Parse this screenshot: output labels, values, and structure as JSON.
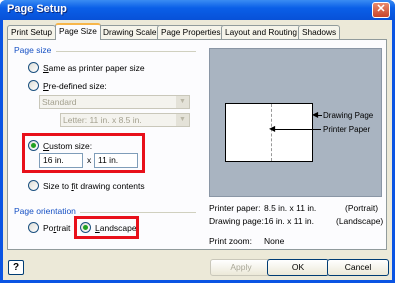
{
  "window": {
    "title": "Page Setup",
    "close_glyph": "✕"
  },
  "tabs": [
    {
      "label": "Print Setup",
      "active": false
    },
    {
      "label": "Page Size",
      "active": true
    },
    {
      "label": "Drawing Scale",
      "active": false
    },
    {
      "label": "Page Properties",
      "active": false
    },
    {
      "label": "Layout and Routing",
      "active": false
    },
    {
      "label": "Shadows",
      "active": false
    }
  ],
  "page_size": {
    "group_label": "Page size",
    "same_as_printer": "ame as printer paper size",
    "same_as_printer_key": "S",
    "predefined": "re-defined size:",
    "predefined_key": "P",
    "predefined_type": "Standard",
    "predefined_size": "Letter:  11 in. x 8.5 in.",
    "custom_key": "C",
    "custom": "ustom size:",
    "custom_width": "16 in.",
    "custom_height": "11 in.",
    "times": "x",
    "fit": "Size to ",
    "fit_key": "f",
    "fit_rest": "it drawing contents",
    "selected": "custom"
  },
  "orientation": {
    "group_label": "Page orientation",
    "portrait_pre": "Po",
    "portrait_key": "r",
    "portrait_post": "trait",
    "landscape_key": "L",
    "landscape": "andscape",
    "selected": "landscape"
  },
  "preview": {
    "drawing_page_label": "Drawing Page",
    "printer_paper_label": "Printer Paper"
  },
  "info": {
    "printer_paper_label": "Printer paper:",
    "printer_paper_value": "8.5 in. x 11 in.",
    "printer_paper_orient": "(Portrait)",
    "drawing_page_label": "Drawing page:",
    "drawing_page_value": "16 in. x 11 in.",
    "drawing_page_orient": "(Landscape)",
    "zoom_label": "Print zoom:",
    "zoom_value": "None"
  },
  "buttons": {
    "help": "?",
    "apply": "Apply",
    "ok": "OK",
    "cancel": "Cancel"
  },
  "colors": {
    "titlebar": "#0a54e3",
    "highlight_box": "#e8101a",
    "group_label": "#1550c4",
    "preview_bg": "#a9b4c1"
  }
}
